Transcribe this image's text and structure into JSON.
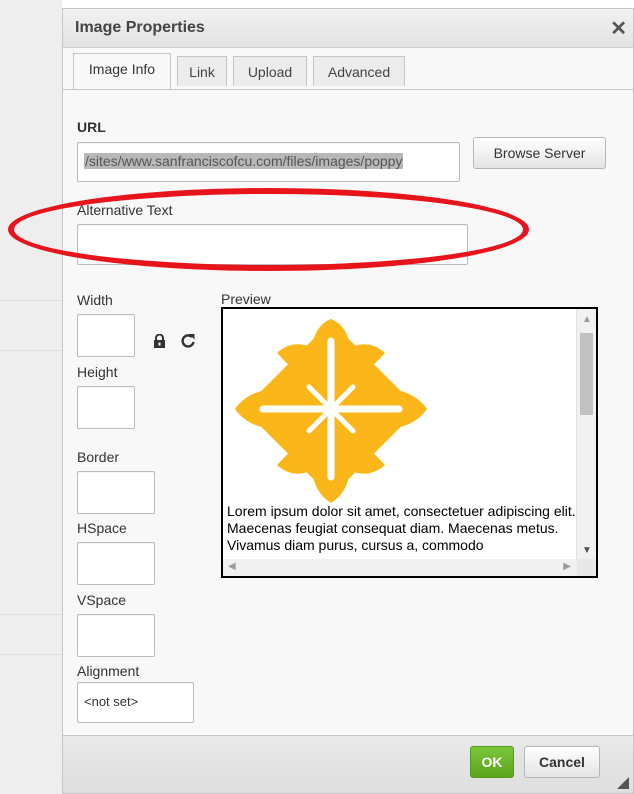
{
  "dialog": {
    "title": "Image Properties",
    "close_glyph": "✕",
    "close_icon": "close-icon"
  },
  "tabs": [
    {
      "label": "Image Info",
      "active": true
    },
    {
      "label": "Link"
    },
    {
      "label": "Upload"
    },
    {
      "label": "Advanced"
    }
  ],
  "url": {
    "label": "URL",
    "value": "/sites/www.sanfranciscofcu.com/files/images/poppy",
    "browse_label": "Browse Server"
  },
  "alt_text": {
    "label": "Alternative Text",
    "value": ""
  },
  "width": {
    "label": "Width",
    "value": ""
  },
  "height": {
    "label": "Height",
    "value": ""
  },
  "lock_icon": "lock-icon",
  "reset_icon": "reset-size-icon",
  "border": {
    "label": "Border",
    "value": ""
  },
  "hspace": {
    "label": "HSpace",
    "value": ""
  },
  "vspace": {
    "label": "VSpace",
    "value": ""
  },
  "alignment": {
    "label": "Alignment",
    "selected": "<not set>"
  },
  "preview": {
    "label": "Preview",
    "text": "Lorem ipsum dolor sit amet, consectetuer adipiscing elit. Maecenas feugiat consequat diam. Maecenas metus. Vivamus diam purus, cursus a, commodo",
    "image_icon": "poppy-flower-logo",
    "image_color": "#fbb71a"
  },
  "footer": {
    "ok_label": "OK",
    "cancel_label": "Cancel"
  },
  "colors": {
    "highlight_ellipse": "#e8141b",
    "ok_button": "#66b032"
  }
}
